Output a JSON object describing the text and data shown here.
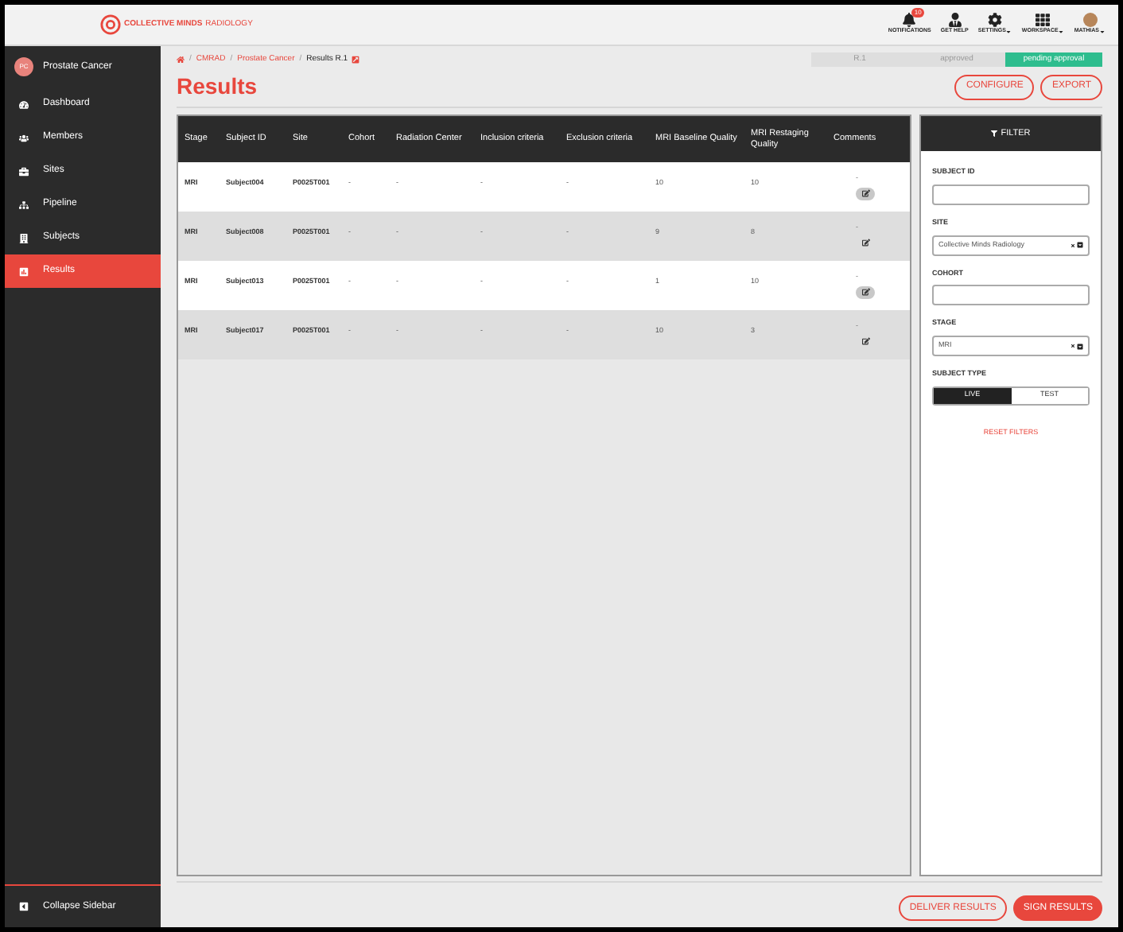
{
  "header": {
    "logo": "COLLECTIVE MINDS",
    "logo_suffix": "RADIOLOGY",
    "nav": [
      {
        "kind": "bell",
        "label": "NOTIFICATIONS",
        "badge": "10",
        "caret": false
      },
      {
        "kind": "help",
        "label": "GET HELP",
        "caret": false
      },
      {
        "kind": "gear",
        "label": "SETTINGS",
        "caret": true
      },
      {
        "kind": "grid",
        "label": "WORKSPACE",
        "caret": true
      },
      {
        "kind": "avatar",
        "label": "MATHIAS",
        "caret": true
      }
    ]
  },
  "sidebar": {
    "project": {
      "initials": "PC",
      "name": "Prostate Cancer"
    },
    "items": [
      {
        "kind": "dashboard",
        "label": "Dashboard",
        "selected": false
      },
      {
        "kind": "members",
        "label": "Members",
        "selected": false
      },
      {
        "kind": "sites",
        "label": "Sites",
        "selected": false
      },
      {
        "kind": "pipeline",
        "label": "Pipeline",
        "selected": false
      },
      {
        "kind": "subjects",
        "label": "Subjects",
        "selected": false
      },
      {
        "kind": "results",
        "label": "Results",
        "selected": true
      }
    ],
    "collapse": "Collapse Sidebar"
  },
  "breadcrumb": [
    "CMRAD",
    "Prostate Cancer"
  ],
  "breadcrumb_separator": "/",
  "breadcrumb_current": "Results R.1",
  "steps": [
    {
      "label": "R.1",
      "selected": false
    },
    {
      "label": "approved",
      "selected": false
    },
    {
      "label": "pending approval",
      "selected": true
    }
  ],
  "title": "Results",
  "actions": [
    "CONFIGURE",
    "EXPORT"
  ],
  "table": {
    "columns": [
      "Stage",
      "Subject ID",
      "Site",
      "Cohort",
      "Radiation Center",
      "Inclusion criteria",
      "Exclusion criteria",
      "MRI Baseline Quality",
      "MRI Restaging Quality",
      "Comments"
    ],
    "rows": [
      {
        "cells": [
          "MRI",
          "Subject004",
          "P0025T001",
          "-",
          "-",
          "-",
          "-",
          "10",
          "10"
        ],
        "comment": "-",
        "round_comment_button": true
      },
      {
        "cells": [
          "MRI",
          "Subject008",
          "P0025T001",
          "-",
          "-",
          "-",
          "-",
          "9",
          "8"
        ],
        "comment": "-",
        "round_comment_button": false
      },
      {
        "cells": [
          "MRI",
          "Subject013",
          "P0025T001",
          "-",
          "-",
          "-",
          "-",
          "1",
          "10"
        ],
        "comment": "-",
        "round_comment_button": true
      },
      {
        "cells": [
          "MRI",
          "Subject017",
          "P0025T001",
          "-",
          "-",
          "-",
          "-",
          "10",
          "3"
        ],
        "comment": "-",
        "round_comment_button": false
      }
    ]
  },
  "filter": {
    "title": "FILTER",
    "fields": [
      {
        "kind": "text",
        "label": "SUBJECT ID"
      },
      {
        "kind": "select",
        "label": "SITE",
        "value": "Collective Minds Radiology"
      },
      {
        "kind": "text",
        "label": "COHORT"
      },
      {
        "kind": "select",
        "label": "STAGE",
        "value": "MRI"
      }
    ],
    "subject_type": {
      "label": "SUBJECT TYPE",
      "options": [
        {
          "label": "LIVE",
          "selected": true
        },
        {
          "label": "TEST",
          "selected": false
        }
      ]
    },
    "reset": "RESET FILTERS"
  },
  "footer_actions": [
    {
      "label": "DELIVER RESULTS",
      "primary": false
    },
    {
      "label": "SIGN RESULTS",
      "primary": true
    }
  ]
}
